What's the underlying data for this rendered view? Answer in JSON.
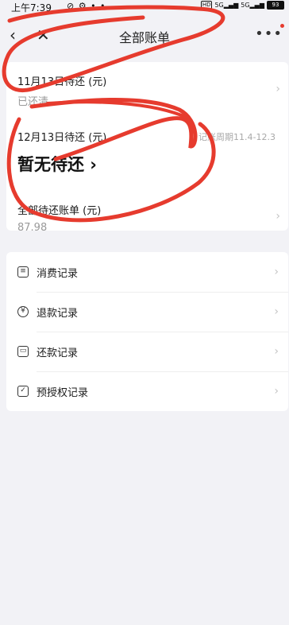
{
  "status_bar": {
    "time": "上午7:39",
    "network_badge": "HD",
    "signal_1": "5G",
    "signal_2": "5G",
    "battery": "93"
  },
  "nav": {
    "title": "全部账单",
    "back_icon": "chevron-left-icon",
    "close_icon": "close-icon",
    "more_icon": "more-dots-icon"
  },
  "bills": {
    "nov": {
      "label": "11月13日待还 (元)",
      "status": "已还清"
    },
    "dec": {
      "label": "12月13日待还 (元)",
      "cycle": "记账周期11.4-12.3",
      "amount_text": "暂无待还 ›"
    },
    "all": {
      "label": "全部待还账单 (元)",
      "amount": "87.98"
    }
  },
  "records": [
    {
      "label": "消费记录",
      "icon": "receipt-icon"
    },
    {
      "label": "退款记录",
      "icon": "refund-icon"
    },
    {
      "label": "还款记录",
      "icon": "card-icon"
    },
    {
      "label": "预授权记录",
      "icon": "checkbox-icon"
    }
  ],
  "colors": {
    "accent_red": "#e63b2e",
    "background": "#f2f2f6"
  }
}
